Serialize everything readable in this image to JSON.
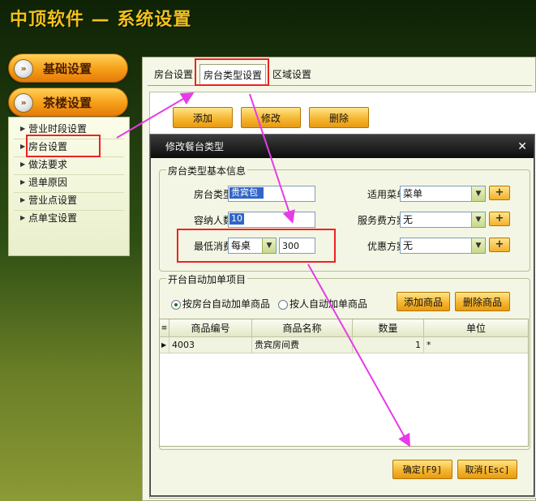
{
  "app": {
    "title": "中顶软件 — 系统设置"
  },
  "sidebar": {
    "basic_label": "基础设置",
    "tea_label": "茶楼设置",
    "items": [
      {
        "label": "营业时段设置"
      },
      {
        "label": "房台设置"
      },
      {
        "label": "做法要求"
      },
      {
        "label": "退单原因"
      },
      {
        "label": "营业点设置"
      },
      {
        "label": "点单宝设置"
      }
    ]
  },
  "tabs": [
    {
      "label": "房台设置"
    },
    {
      "label": "房台类型设置"
    },
    {
      "label": "区域设置"
    }
  ],
  "toolbar": {
    "add": "添加",
    "edit": "修改",
    "delete": "删除"
  },
  "dialog": {
    "title": "修改餐台类型",
    "close_glyph": "✕",
    "basic_group": "房台类型基本信息",
    "fields": {
      "room_type_label": "房台类型",
      "room_type_value": "贵宾包",
      "capacity_label": "容纳人数",
      "capacity_value": "10",
      "min_spend_label": "最低消费",
      "min_spend_unit": "每桌",
      "min_spend_value": "300",
      "menu_label": "适用菜单",
      "menu_value": "菜单",
      "service_label": "服务费方案",
      "service_value": "无",
      "discount_label": "优惠方案",
      "discount_value": "无",
      "plus": "+"
    },
    "auto_group": "开台自动加单项目",
    "radio_by_room": "按房台自动加单商品",
    "radio_by_person": "按人自动加单商品",
    "add_goods": "添加商品",
    "delete_goods": "删除商品",
    "grid": {
      "columns": [
        "商品编号",
        "商品名称",
        "数量",
        "单位"
      ],
      "rows": [
        {
          "code": "4003",
          "name": "贵宾房间费",
          "qty": "1",
          "unit": "*"
        }
      ]
    },
    "ok": "确定[F9]",
    "cancel": "取消[Esc]"
  },
  "colors": {
    "accent_orange": "#f7a21b",
    "highlight_red": "#ee2222",
    "arrow_magenta": "#e63ce6"
  }
}
